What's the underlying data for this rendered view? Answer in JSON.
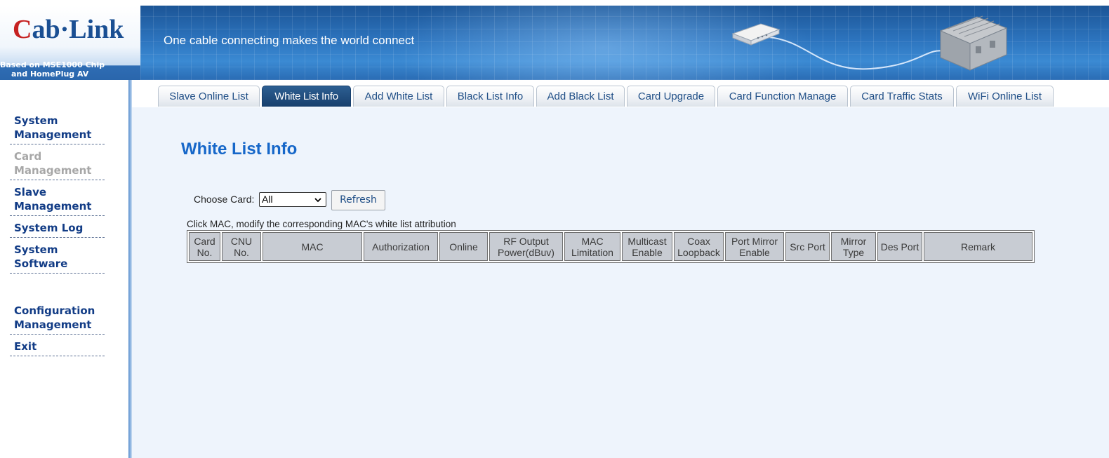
{
  "brand": {
    "logo": "Cab·Link",
    "logo_initial": "C",
    "logo_rest": "ab·Link",
    "subtitle_line1": "Based on MSE1000 Chip",
    "subtitle_line2": "and HomePlug AV standard",
    "slogan": "One cable connecting makes the world connect"
  },
  "sidebar": {
    "items": [
      {
        "label": "System Management",
        "disabled": false
      },
      {
        "label": "Card Management",
        "disabled": true
      },
      {
        "label": "Slave Management",
        "disabled": false
      },
      {
        "label": "System Log",
        "disabled": false
      },
      {
        "label": "System Software",
        "disabled": false
      },
      {
        "label": "Configuration Management",
        "disabled": false
      },
      {
        "label": "Exit",
        "disabled": false
      }
    ]
  },
  "tabs": [
    {
      "label": "Slave Online List"
    },
    {
      "label": "White List Info",
      "active": true
    },
    {
      "label": "Add White List"
    },
    {
      "label": "Black List Info"
    },
    {
      "label": "Add Black List"
    },
    {
      "label": "Card Upgrade"
    },
    {
      "label": "Card Function Manage"
    },
    {
      "label": "Card Traffic Stats"
    },
    {
      "label": "WiFi Online List"
    }
  ],
  "main": {
    "title": "White List Info",
    "choose_card_label": "Choose Card:",
    "choose_card_value": "All",
    "refresh_label": "Refresh",
    "hint": "Click MAC, modify the corresponding MAC's white list attribution",
    "columns": [
      "Card No.",
      "CNU No.",
      "MAC",
      "Authorization",
      "Online",
      "RF Output Power(dBuv)",
      "MAC Limitation",
      "Multicast Enable",
      "Coax Loopback",
      "Port Mirror Enable",
      "Src Port",
      "Mirror Type",
      "Des Port",
      "Remark"
    ]
  },
  "colors": {
    "accent": "#1667c9",
    "nav_text": "#123c86",
    "active_tab": "#173f6d",
    "content_bg": "#eef4fc",
    "table_header": "#c8ccd3"
  }
}
